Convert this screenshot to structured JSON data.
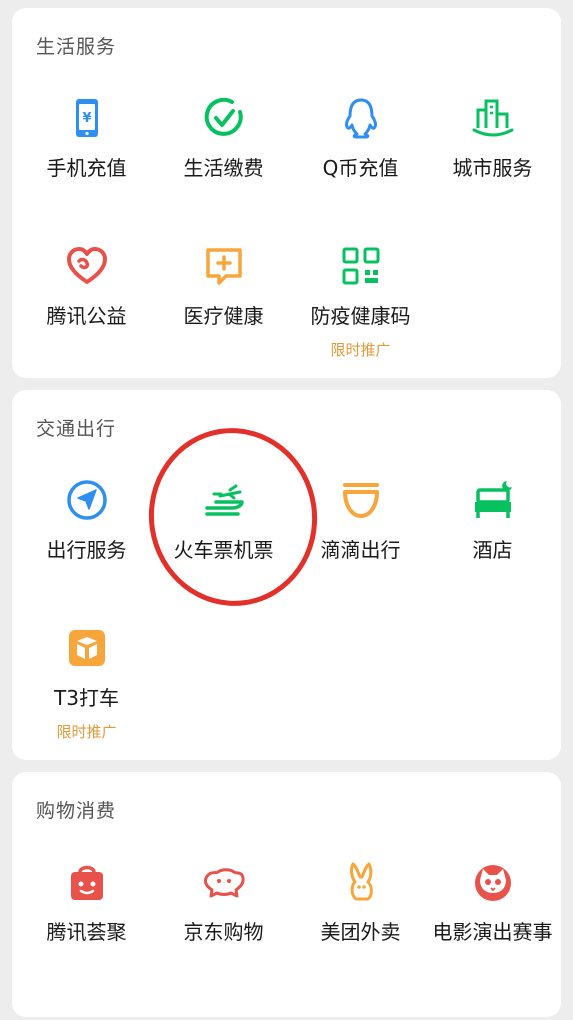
{
  "sections": [
    {
      "title": "生活服务",
      "items": [
        {
          "label": "手机充值",
          "icon": "phone-recharge-icon"
        },
        {
          "label": "生活缴费",
          "icon": "utility-payment-icon"
        },
        {
          "label": "Q币充值",
          "icon": "qq-coin-icon"
        },
        {
          "label": "城市服务",
          "icon": "city-services-icon"
        },
        {
          "label": "腾讯公益",
          "icon": "charity-heart-icon"
        },
        {
          "label": "医疗健康",
          "icon": "medical-health-icon"
        },
        {
          "label": "防疫健康码",
          "icon": "health-code-icon",
          "promo": "限时推广"
        }
      ]
    },
    {
      "title": "交通出行",
      "items": [
        {
          "label": "出行服务",
          "icon": "navigation-icon"
        },
        {
          "label": "火车票机票",
          "icon": "train-plane-icon"
        },
        {
          "label": "滴滴出行",
          "icon": "didi-icon"
        },
        {
          "label": "酒店",
          "icon": "hotel-bed-icon"
        },
        {
          "label": "T3打车",
          "icon": "t3-taxi-icon",
          "promo": "限时推广"
        }
      ]
    },
    {
      "title": "购物消费",
      "items": [
        {
          "label": "腾讯荟聚",
          "icon": "tencent-shop-bag-icon"
        },
        {
          "label": "京东购物",
          "icon": "jd-dog-icon"
        },
        {
          "label": "美团外卖",
          "icon": "meituan-kangaroo-icon"
        },
        {
          "label": "电影演出赛事",
          "icon": "maoyan-cat-icon"
        }
      ]
    }
  ],
  "colors": {
    "green": "#07c160",
    "blue": "#2f8ff0",
    "orange": "#f6a63b",
    "red": "#e8524a",
    "promo": "#e19a3b",
    "annotation": "#e2302a"
  }
}
